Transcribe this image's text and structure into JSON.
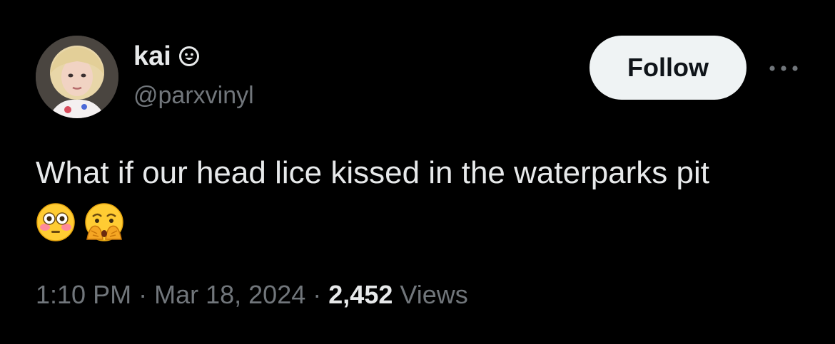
{
  "author": {
    "display_name": "kai",
    "handle": "@parxvinyl"
  },
  "actions": {
    "follow_label": "Follow"
  },
  "tweet": {
    "text": "What if our head lice kissed in the waterparks pit",
    "emojis": [
      "flushed-face",
      "face-with-open-eyes-and-hand-over-mouth"
    ]
  },
  "meta": {
    "time": "1:10 PM",
    "separator": "·",
    "date": "Mar 18, 2024",
    "views_count": "2,452",
    "views_label": "Views"
  },
  "colors": {
    "background": "#000000",
    "primary_text": "#e7e9ea",
    "secondary_text": "#71767b",
    "follow_bg": "#eff3f4",
    "follow_text": "#0f1419"
  }
}
